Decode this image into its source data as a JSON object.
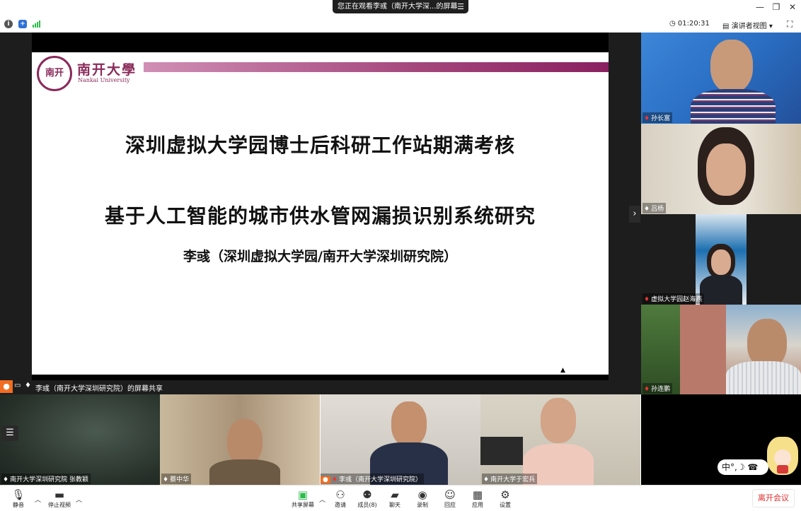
{
  "title_bar": {
    "viewing_text": "您正在观看李彧（南开大学深...的屏幕",
    "menu_icon": "menu-icon",
    "minimize": "—",
    "restore": "❐",
    "close": "✕"
  },
  "info_bar": {
    "meeting_info_icon": "info-icon",
    "security_icon": "shield-icon",
    "signal_icon": "signal-icon",
    "timer": "01:20:31",
    "view_button": "演讲者视图",
    "fullscreen_icon": "fullscreen-icon"
  },
  "slide": {
    "logo_seal_text": "南开",
    "logo_cn": "南开大學",
    "logo_en": "Nankai University",
    "title_line1": "深圳虚拟大学园博士后科研工作站期满考核",
    "title_line2": "基于人工智能的城市供水管网漏损识别系统研究",
    "author": "李彧（深圳虚拟大学园/南开大学深圳研究院）"
  },
  "share_status": {
    "text": "李彧（南开大学深圳研究院）的屏幕共享"
  },
  "right_gallery": [
    {
      "name": "孙长富",
      "bg": "#2a6fc4"
    },
    {
      "name": "吕杨",
      "bg": "#e7e0d4"
    },
    {
      "name": "虚拟大学园赵海燕",
      "bg": "#1d1d1d"
    },
    {
      "name": "孙连鹏",
      "bg": "#6d8fb0"
    }
  ],
  "bottom_gallery": [
    {
      "name": "南开大学深圳研究院 张教颖",
      "bg": "#2f3a33"
    },
    {
      "name": "蔡中华",
      "bg": "#b9a58a"
    },
    {
      "name": "李彧（南开大学深圳研究院）",
      "bg": "#cfcbc4"
    },
    {
      "name": "南开大学于宏兵",
      "bg": "#d8d2c4"
    }
  ],
  "avatar_overlay": {
    "ime_text": "中°,☽ ☎"
  },
  "toolbar": {
    "mute": "静音",
    "stop_video": "停止视频",
    "share_screen": "共享屏幕",
    "invite": "邀请",
    "participants": "成员(8)",
    "chat": "聊天",
    "record": "录制",
    "reactions": "回应",
    "apps": "应用",
    "settings": "设置",
    "leave": "离开会议"
  },
  "colors": {
    "accent_brand": "#8a2a5a",
    "leave_red": "#e02b2b",
    "share_green": "#2dbb4c",
    "presenter_orange": "#f26d21"
  }
}
